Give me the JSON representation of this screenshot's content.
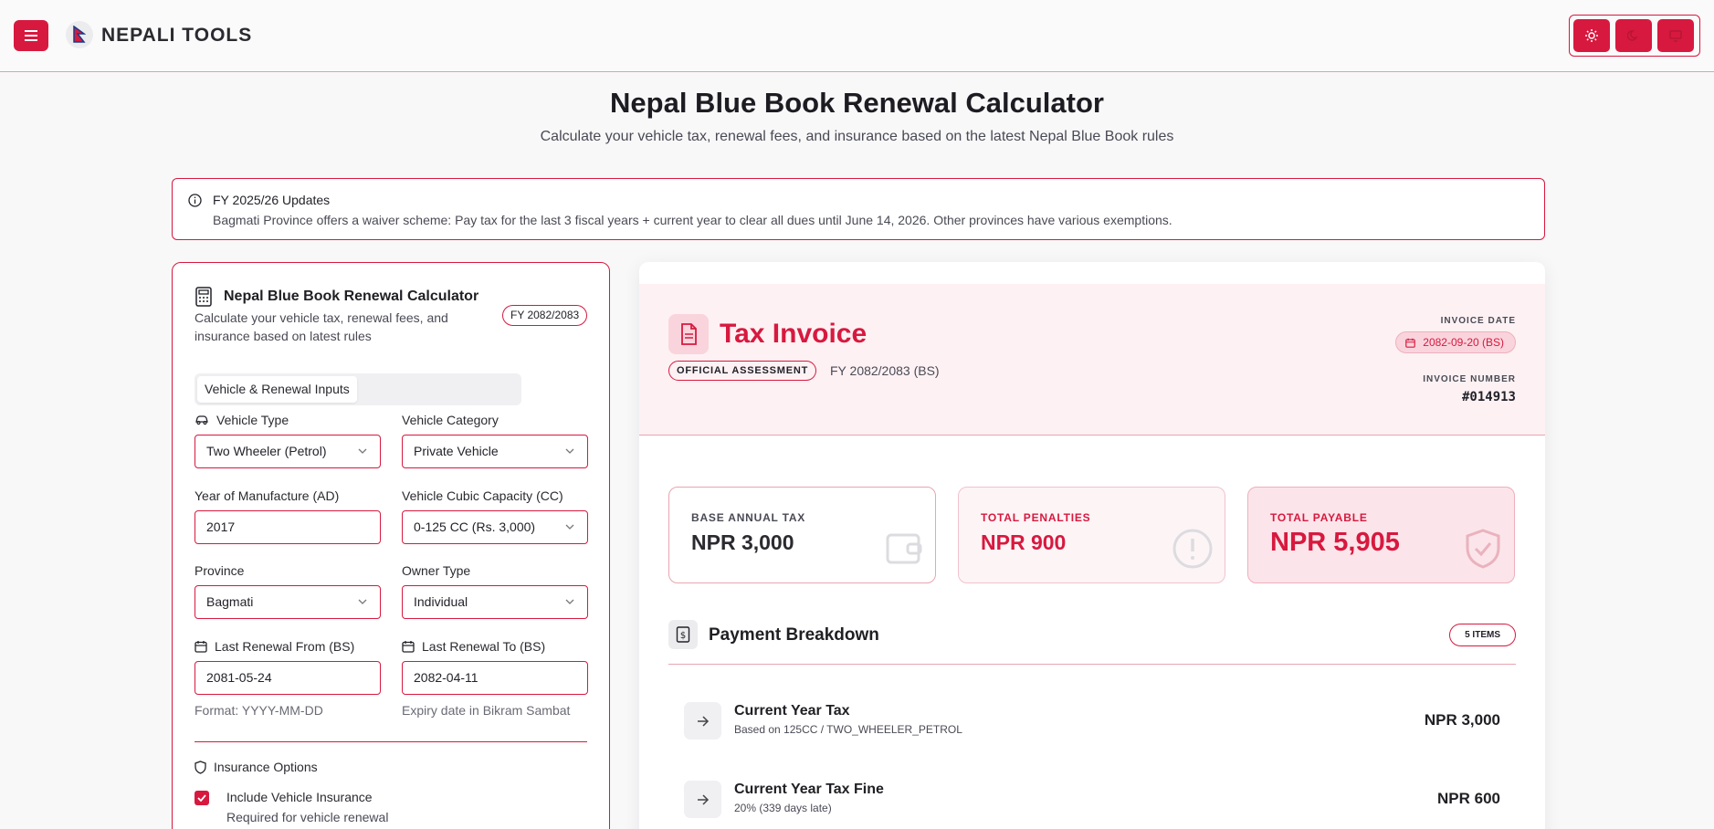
{
  "header": {
    "brand": "NEPALI TOOLS",
    "menu_icon": "hamburger-icon",
    "theme_buttons": [
      "sun-icon",
      "moon-icon",
      "monitor-icon"
    ]
  },
  "page": {
    "title": "Nepal Blue Book Renewal Calculator",
    "subtitle": "Calculate your vehicle tax, renewal fees, and insurance based on the latest Nepal Blue Book rules"
  },
  "alert": {
    "title": "FY 2025/26 Updates",
    "text": "Bagmati Province offers a waiver scheme: Pay tax for the last 3 fiscal years + current year to clear all dues until June 14, 2026. Other provinces have various exemptions."
  },
  "calculator": {
    "title": "Nepal Blue Book Renewal Calculator",
    "subtitle": "Calculate your vehicle tax, renewal fees, and insurance based on latest rules",
    "fy_badge": "FY 2082/2083",
    "tab": "Vehicle & Renewal Inputs",
    "vehicle_type": {
      "label": "Vehicle Type",
      "value": "Two Wheeler (Petrol)"
    },
    "vehicle_category": {
      "label": "Vehicle Category",
      "value": "Private Vehicle"
    },
    "year": {
      "label": "Year of Manufacture (AD)",
      "value": "2017"
    },
    "cc": {
      "label": "Vehicle Cubic Capacity (CC)",
      "value": "0-125 CC (Rs. 3,000)"
    },
    "province": {
      "label": "Province",
      "value": "Bagmati"
    },
    "owner_type": {
      "label": "Owner Type",
      "value": "Individual"
    },
    "renewal_from": {
      "label": "Last Renewal From (BS)",
      "value": "2081-05-24",
      "help": "Format: YYYY-MM-DD"
    },
    "renewal_to": {
      "label": "Last Renewal To (BS)",
      "value": "2082-04-11",
      "help": "Expiry date in Bikram Sambat"
    },
    "insurance": {
      "label": "Insurance Options",
      "checkbox_label": "Include Vehicle Insurance",
      "checkbox_help": "Required for vehicle renewal",
      "checked": true
    }
  },
  "invoice": {
    "title": "Tax Invoice",
    "badge": "OFFICIAL ASSESSMENT",
    "fy": "FY 2082/2083 (BS)",
    "date_label": "INVOICE DATE",
    "date": "2082-09-20 (BS)",
    "number_label": "INVOICE NUMBER",
    "number": "#014913",
    "stats": [
      {
        "label": "BASE ANNUAL TAX",
        "value": "NPR 3,000"
      },
      {
        "label": "TOTAL PENALTIES",
        "value": "NPR 900"
      },
      {
        "label": "TOTAL PAYABLE",
        "value": "NPR 5,905"
      }
    ],
    "breakdown_title": "Payment Breakdown",
    "breakdown_count": "5 ITEMS",
    "items": [
      {
        "title": "Current Year Tax",
        "sub": "Based on 125CC / TWO_WHEELER_PETROL",
        "amount": "NPR 3,000"
      },
      {
        "title": "Current Year Tax Fine",
        "sub": "20% (339 days late)",
        "amount": "NPR 600"
      }
    ]
  },
  "colors": {
    "accent": "#d7193f",
    "invoice_head_bg": "#fdf1f3"
  }
}
